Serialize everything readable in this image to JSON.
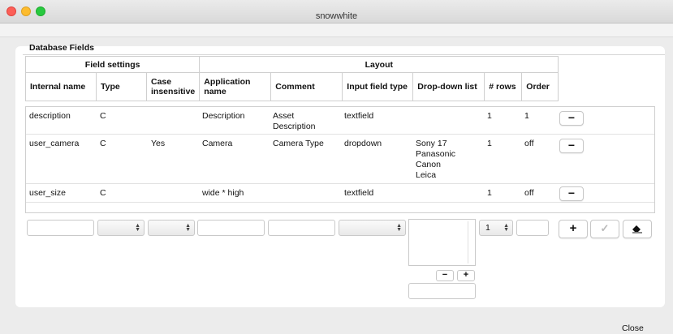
{
  "window": {
    "title": "snowwhite"
  },
  "section": {
    "title": "Database Fields"
  },
  "header": {
    "groups": [
      "Field settings",
      "Layout"
    ],
    "columns": [
      "Internal name",
      "Type",
      "Case insensitive",
      "Application name",
      "Comment",
      "Input field type",
      "Drop-down list",
      "# rows",
      "Order"
    ]
  },
  "rows": [
    {
      "internal_name": "description",
      "type": "C",
      "case_insensitive": "",
      "application_name": "Description",
      "comment": "Asset Description",
      "input_field_type": "textfield",
      "dropdown_list": [],
      "rows": "1",
      "order": "1"
    },
    {
      "internal_name": "user_camera",
      "type": "C",
      "case_insensitive": "Yes",
      "application_name": "Camera",
      "comment": "Camera Type",
      "input_field_type": "dropdown",
      "dropdown_list": [
        "Sony 17",
        "Panasonic",
        "Canon",
        "Leica"
      ],
      "rows": "1",
      "order": "off"
    },
    {
      "internal_name": "user_size",
      "type": "C",
      "case_insensitive": "",
      "application_name": "wide * high",
      "comment": "",
      "input_field_type": "textfield",
      "dropdown_list": [],
      "rows": "1",
      "order": "off"
    }
  ],
  "row_remove_icon": "minus-icon",
  "editor": {
    "internal_name_value": "",
    "type_value": "",
    "case_value": "",
    "application_name_value": "",
    "comment_value": "",
    "input_type_value": "",
    "rows_value": "1",
    "order_value": "",
    "list_add_icon": "plus-icon",
    "list_remove_icon": "minus-icon",
    "add_icon": "plus-icon",
    "apply_icon": "checkmark-icon",
    "clear_icon": "eraser-icon"
  },
  "footer": {
    "close_label": "Close"
  }
}
